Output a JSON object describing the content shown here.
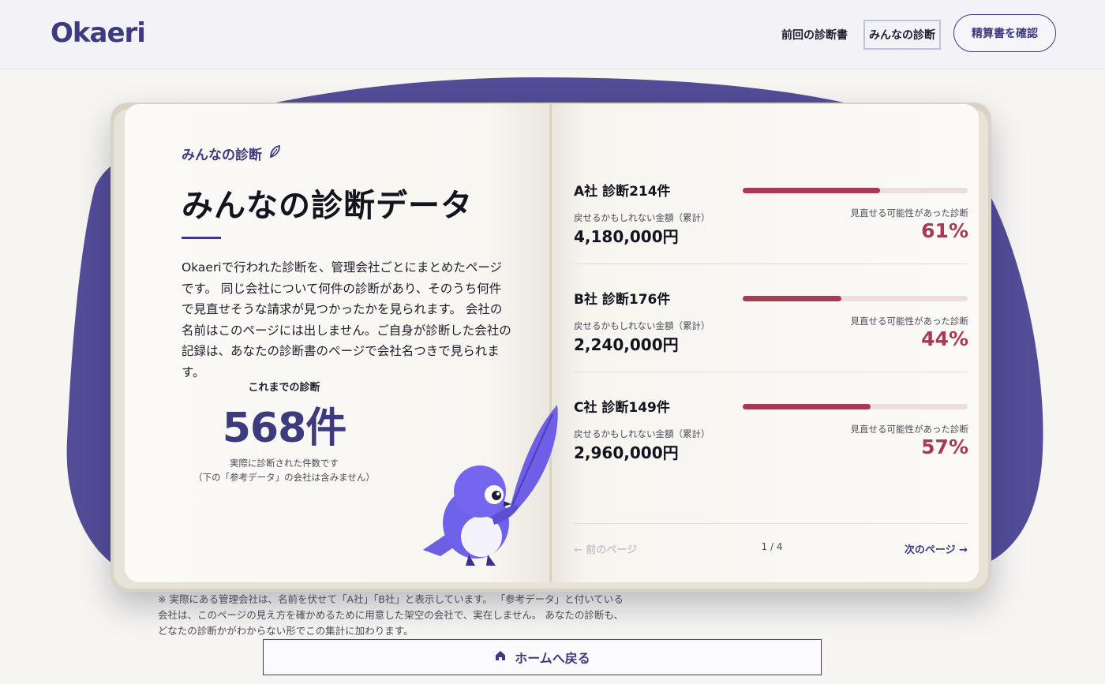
{
  "header": {
    "logo": "Okaeri",
    "nav_prev": "前回の診断書",
    "nav_everyone": "みんなの診断",
    "nav_button": "精算書を確認"
  },
  "left": {
    "eyebrow": "みんなの診断",
    "title": "みんなの診断データ",
    "intro": "Okaeriで行われた診断を、管理会社ごとにまとめたページです。 同じ会社について何件の診断があり、そのうち何件で見直せそうな請求が見つかったかを見られます。 会社の名前はこのページには出しません。ご自身が診断した会社の記録は、あなたの診断書のページで会社名つきで見られます。",
    "total_label": "これまでの診断",
    "total_value": "568件",
    "total_note_1": "実際に診断された件数です",
    "total_note_2": "（下の「参考データ」の会社は含みません）"
  },
  "companies": [
    {
      "name": "A社  診断214件",
      "amount_label": "戻せるかもしれない金額（累計）",
      "amount": "4,180,000円",
      "rate_label": "見直せる可能性があった診断",
      "rate": "61%",
      "rate_value": 61
    },
    {
      "name": "B社  診断176件",
      "amount_label": "戻せるかもしれない金額（累計）",
      "amount": "2,240,000円",
      "rate_label": "見直せる可能性があった診断",
      "rate": "44%",
      "rate_value": 44
    },
    {
      "name": "C社  診断149件",
      "amount_label": "戻せるかもしれない金額（累計）",
      "amount": "2,960,000円",
      "rate_label": "見直せる可能性があった診断",
      "rate": "57%",
      "rate_value": 57
    }
  ],
  "pager": {
    "prev": "← 前のページ",
    "page": "1 / 4",
    "next": "次のページ →"
  },
  "footnote": "※ 実際にある管理会社は、名前を伏せて「A社」「B社」と表示しています。 「参考データ」と付いている会社は、このページの見え方を確かめるために用意した架空の会社で、実在しません。 あなたの診断も、どなたの診断かがわからない形でこの集計に加わります。",
  "home_button": "ホームへ戻る",
  "colors": {
    "brand": "#3e3a7e",
    "accent": "#a83a55",
    "blob": "#534d98"
  }
}
